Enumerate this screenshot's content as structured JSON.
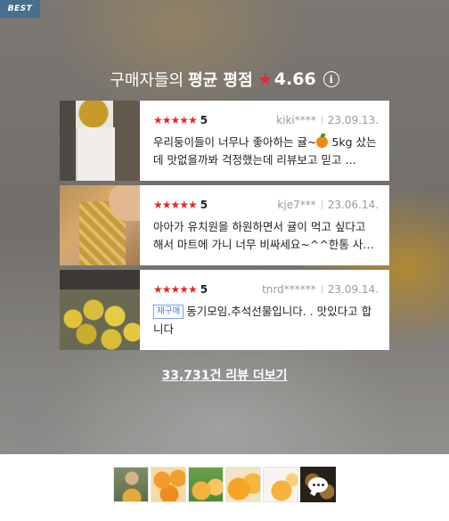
{
  "badge": "BEST",
  "header": {
    "title_prefix": "구매자들의",
    "title_bold": "평균 평점",
    "star": "★",
    "score": "4.66",
    "info_symbol": "i"
  },
  "reviews": [
    {
      "stars": "★★★★★",
      "rating": "5",
      "user": "kiki****",
      "date": "23.09.13.",
      "text_before_icon": "우리둥이들이 너무나 좋아하는 귤~",
      "icon": "orange-emoji",
      "text_after_icon": " 5kg 샀는데 맛없을까봐 걱정했는데 리뷰보고 믿고 …",
      "thumbnail": "cup-with-orange-photo"
    },
    {
      "stars": "★★★★★",
      "rating": "5",
      "user": "kje7***",
      "date": "23.06.14.",
      "text": "아아가 유치원을 하원하면서 귤이 먹고 싶다고 해서 마트에 가니 너무 비싸세요~^^한통 사…",
      "thumbnail": "box-of-oranges-photo"
    },
    {
      "stars": "★★★★★",
      "rating": "5",
      "user": "tnrd******",
      "date": "23.09.14.",
      "tag": "재구매",
      "text": "동기모임.추석선물입니다. . 맛있다고 합니다",
      "thumbnail": "crate-of-oranges-photo"
    }
  ],
  "more_link": "33,731건 리뷰 더보기",
  "gallery": {
    "thumbnails": [
      "person-with-oranges",
      "orange-slices",
      "oranges-on-tree",
      "cut-oranges",
      "orange-halves",
      "more-reviews"
    ],
    "more_icon": "speech-bubble-icon"
  },
  "colors": {
    "star": "#e4282b",
    "badge": "#46708c",
    "repurchase_tag": "#3f7ad6"
  }
}
